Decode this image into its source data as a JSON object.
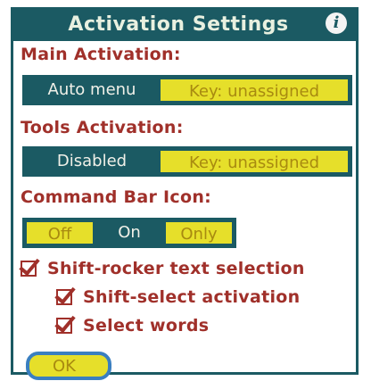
{
  "dialog": {
    "title": "Activation Settings",
    "info_icon": "i"
  },
  "main_activation": {
    "label": "Main Activation:",
    "mode": "Auto menu",
    "key": "Key: unassigned"
  },
  "tools_activation": {
    "label": "Tools Activation:",
    "mode": "Disabled",
    "key": "Key: unassigned"
  },
  "command_bar_icon": {
    "label": "Command Bar Icon:",
    "options": [
      "Off",
      "On",
      "Only"
    ],
    "selected": "On"
  },
  "checkboxes": {
    "shift_rocker": {
      "label": "Shift-rocker text selection",
      "checked": true
    },
    "shift_select": {
      "label": "Shift-select activation",
      "checked": true
    },
    "select_words": {
      "label": "Select words",
      "checked": true
    }
  },
  "ok_button": {
    "label": "OK"
  },
  "colors": {
    "teal": "#1b5a63",
    "yellow": "#e6df2a",
    "red_text": "#a0302a",
    "focus_ring": "#3a7fc0"
  }
}
